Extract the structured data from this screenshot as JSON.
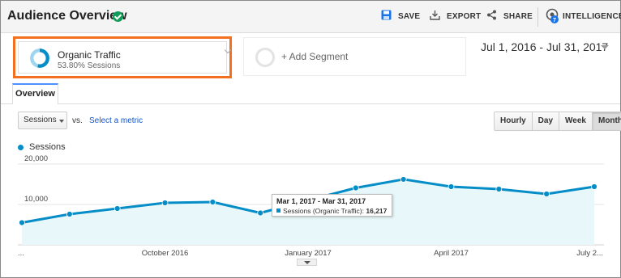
{
  "header": {
    "title": "Audience Overview",
    "actions": [
      {
        "label": "SAVE",
        "icon": "save-icon"
      },
      {
        "label": "EXPORT",
        "icon": "export-icon"
      },
      {
        "label": "SHARE",
        "icon": "share-icon"
      },
      {
        "label": "INTELLIGENCE",
        "icon": "intelligence-icon",
        "badge": "7"
      }
    ]
  },
  "segments": {
    "active": {
      "name": "Organic Traffic",
      "subtitle": "53.80% Sessions",
      "share": 0.538
    },
    "add_label": "+ Add Segment"
  },
  "date_range": "Jul 1, 2016 - Jul 31, 2017",
  "tabs": [
    "Overview"
  ],
  "controls": {
    "metric": "Sessions",
    "vs": "vs.",
    "select_metric": "Select a metric",
    "granularity": [
      "Hourly",
      "Day",
      "Week",
      "Month"
    ],
    "active_granularity": "Month"
  },
  "legend": {
    "label": "Sessions",
    "color": "#058dc7"
  },
  "tooltip": {
    "date": "Mar 1, 2017 - Mar 31, 2017",
    "series": "Sessions (Organic Traffic):",
    "value": "16,217"
  },
  "colors": {
    "accent": "#058dc7",
    "highlight": "#f37021",
    "fill": "#e8f7f9"
  },
  "chart_data": {
    "type": "line",
    "x": [
      "Jul 2016",
      "Aug 2016",
      "Sep 2016",
      "Oct 2016",
      "Nov 2016",
      "Dec 2016",
      "Jan 2017",
      "Feb 2017",
      "Mar 2017",
      "Apr 2017",
      "May 2017",
      "Jun 2017",
      "Jul 2017"
    ],
    "series": [
      {
        "name": "Sessions",
        "values": [
          5500,
          7600,
          9000,
          10400,
          10600,
          7900,
          11000,
          14100,
          16217,
          14400,
          13800,
          12600,
          14400
        ]
      }
    ],
    "ylim": [
      0,
      22000
    ],
    "yticks": [
      {
        "value": 10000,
        "label": "10,000"
      },
      {
        "value": 20000,
        "label": "20,000"
      }
    ],
    "xticks": [
      {
        "index": 0,
        "label": "..."
      },
      {
        "index": 3,
        "label": "October 2016"
      },
      {
        "index": 6,
        "label": "January 2017"
      },
      {
        "index": 9,
        "label": "April 2017"
      },
      {
        "index": 12,
        "label": "July 2..."
      }
    ],
    "grid": true
  }
}
